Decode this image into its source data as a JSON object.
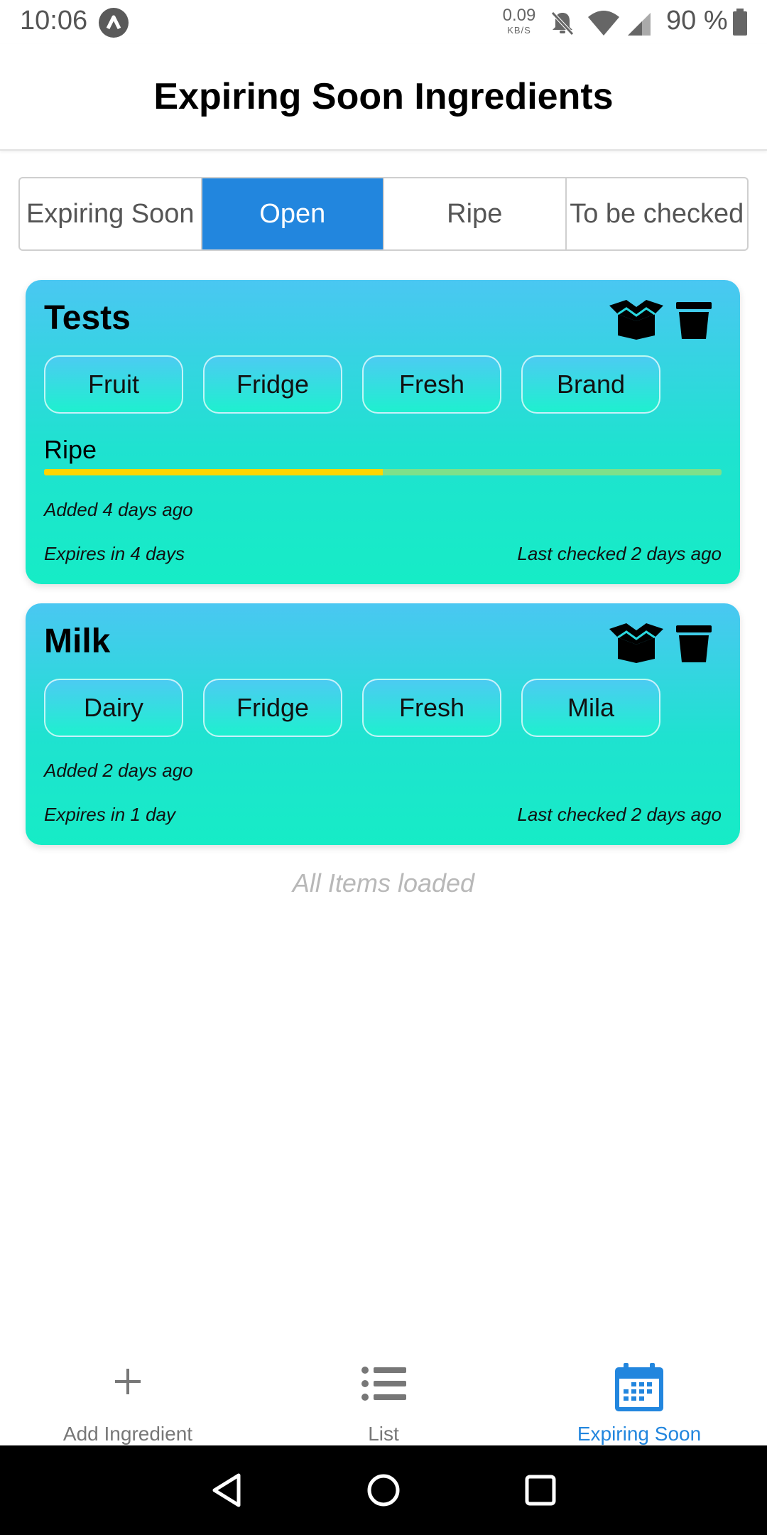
{
  "status_bar": {
    "time": "10:06",
    "speed_value": "0.09",
    "speed_unit": "KB/S",
    "battery_text": "90 %",
    "icons": [
      "app-notification-icon",
      "bell-off-icon",
      "wifi-icon",
      "signal-icon",
      "battery-icon"
    ]
  },
  "header": {
    "title": "Expiring Soon Ingredients"
  },
  "tabs": [
    {
      "label": "Expiring Soon",
      "active": false
    },
    {
      "label": "Open",
      "active": true
    },
    {
      "label": "Ripe",
      "active": false
    },
    {
      "label": "To be checked",
      "active": false
    }
  ],
  "cards": [
    {
      "title": "Tests",
      "tags": [
        "Fruit",
        "Fridge",
        "Fresh",
        "Brand"
      ],
      "ripe_label": "Ripe",
      "ripe_progress": 0.5,
      "added": "Added 4 days ago",
      "expires": "Expires in 4 days",
      "last_checked": "Last checked 2 days ago",
      "icons": [
        "open-box-icon",
        "trash-icon"
      ]
    },
    {
      "title": "Milk",
      "tags": [
        "Dairy",
        "Fridge",
        "Fresh",
        "Mila"
      ],
      "added": "Added 2 days ago",
      "expires": "Expires in 1 day",
      "last_checked": "Last checked 2 days ago",
      "icons": [
        "open-box-icon",
        "trash-icon"
      ]
    }
  ],
  "list_footer": "All Items loaded",
  "bottom_nav": [
    {
      "label": "Add Ingredient",
      "icon": "plus-icon",
      "active": false
    },
    {
      "label": "List",
      "icon": "list-icon",
      "active": false
    },
    {
      "label": "Expiring Soon",
      "icon": "calendar-icon",
      "active": true
    }
  ],
  "colors": {
    "accent": "#2286de",
    "card_top": "#4ac7f2",
    "card_bottom": "#16ecc6",
    "ripe_fill": "#ffd600",
    "ripe_track": "#7ee08a"
  }
}
